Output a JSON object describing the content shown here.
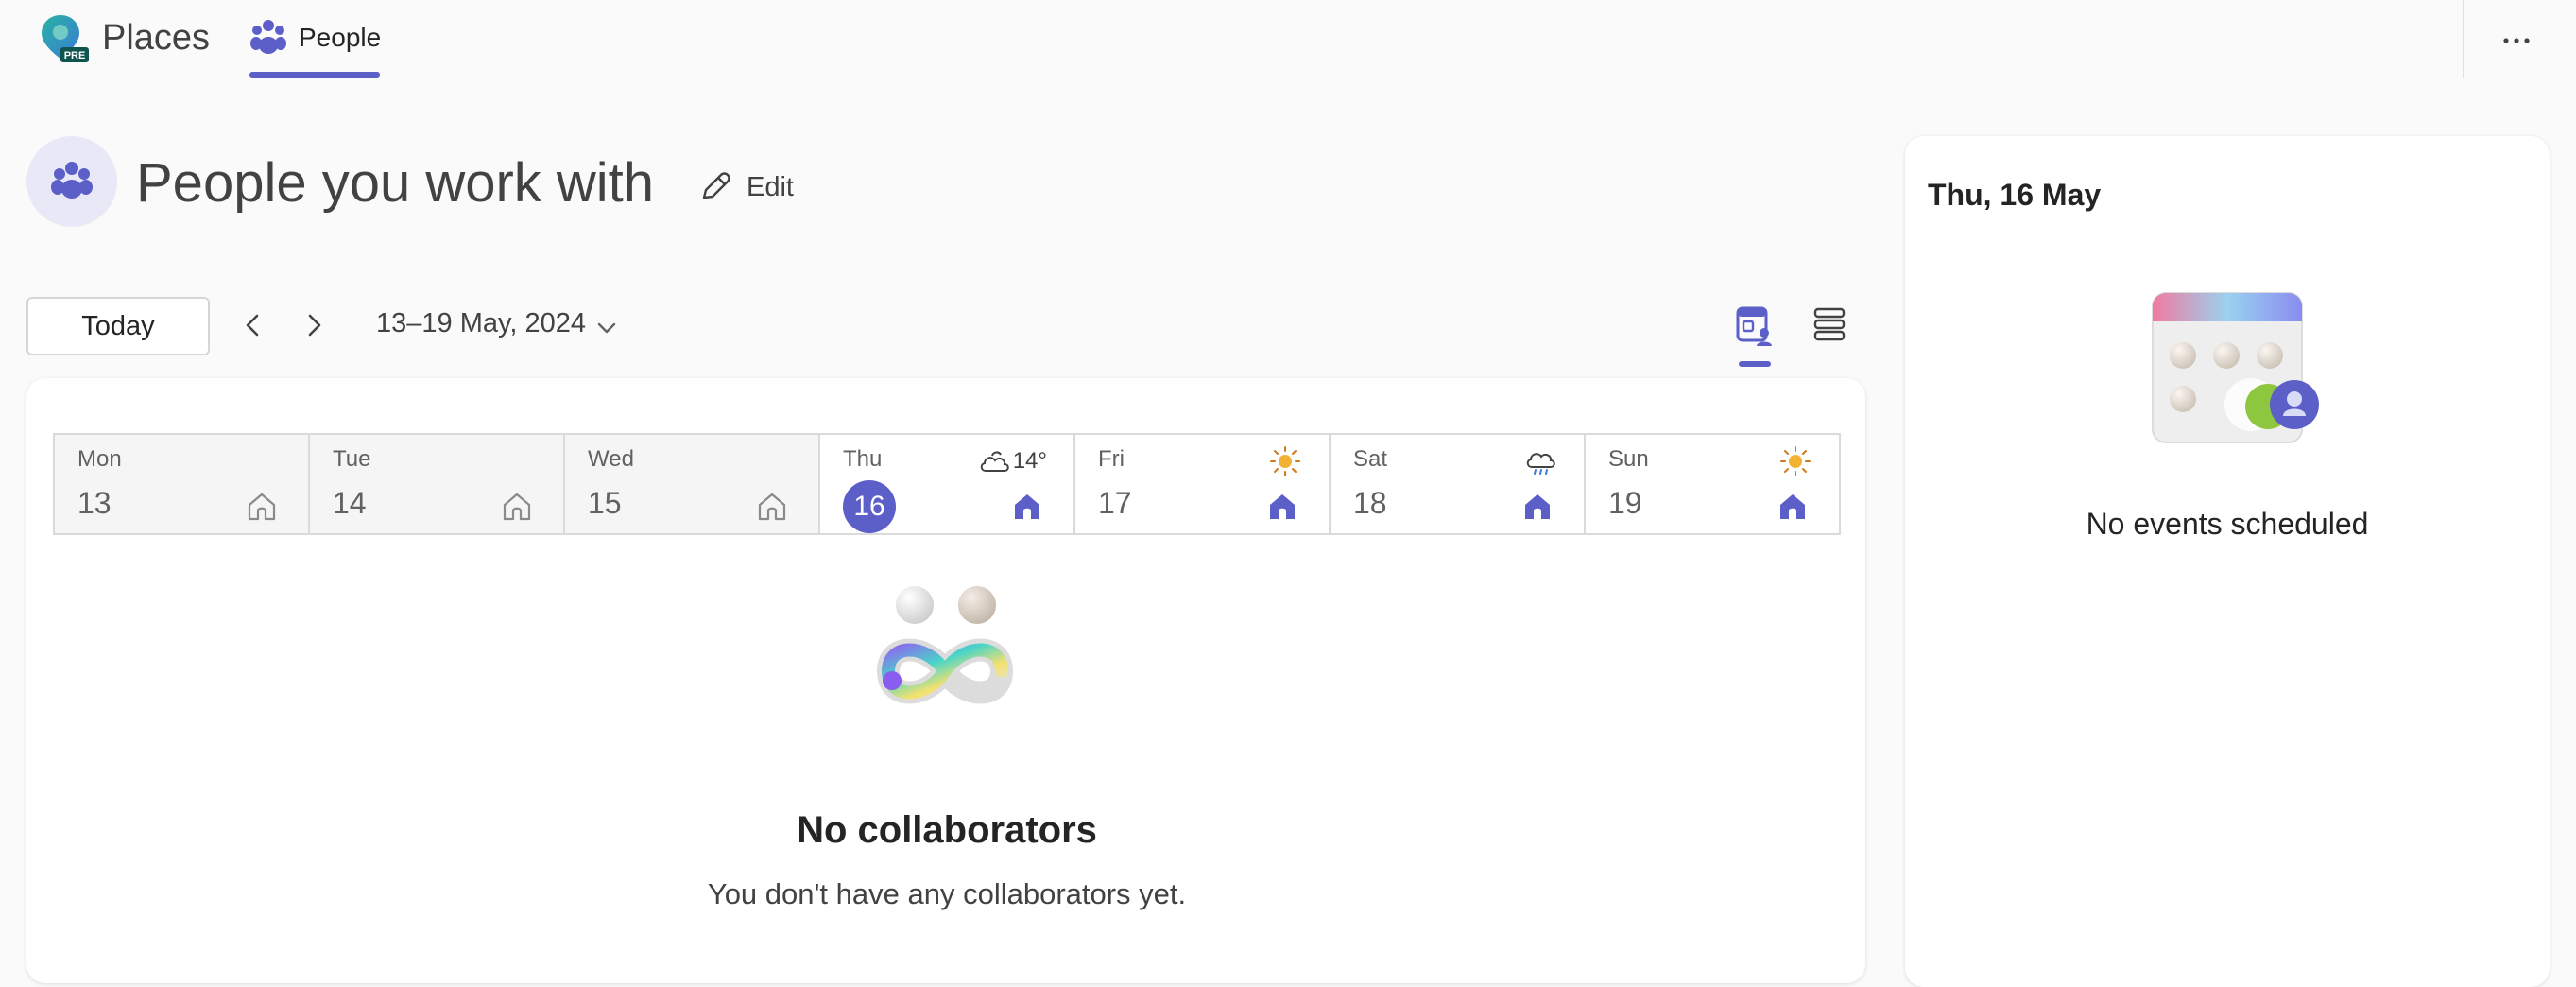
{
  "app": {
    "name": "Places",
    "logo_badge": "PRE",
    "tab_people": "People",
    "accent_color": "#5b5fc7"
  },
  "header": {
    "title": "People you work with",
    "edit_label": "Edit",
    "icon": "people-group-icon"
  },
  "nav": {
    "today_label": "Today",
    "date_range": "13–19 May, 2024",
    "prev_icon": "chevron-left-icon",
    "next_icon": "chevron-right-icon",
    "views": [
      "calendar-people-view-icon",
      "list-view-icon"
    ],
    "selected_view": "calendar-people-view"
  },
  "week": {
    "days": [
      {
        "name": "Mon",
        "num": "13",
        "location": "home",
        "past": true
      },
      {
        "name": "Tue",
        "num": "14",
        "location": "home",
        "past": true
      },
      {
        "name": "Wed",
        "num": "15",
        "location": "home",
        "past": true
      },
      {
        "name": "Thu",
        "num": "16",
        "location": "home",
        "today": true,
        "weather": "partly-cloudy-icon",
        "temp": "14°"
      },
      {
        "name": "Fri",
        "num": "17",
        "location": "home",
        "weather": "sunny-icon"
      },
      {
        "name": "Sat",
        "num": "18",
        "location": "home",
        "weather": "rain-cloud-icon"
      },
      {
        "name": "Sun",
        "num": "19",
        "location": "home",
        "weather": "sunny-icon"
      }
    ]
  },
  "empty_state": {
    "title": "No collaborators",
    "subtitle": "You don't have any collaborators yet."
  },
  "side_panel": {
    "date": "Thu, 16 May",
    "message": "No events scheduled"
  }
}
